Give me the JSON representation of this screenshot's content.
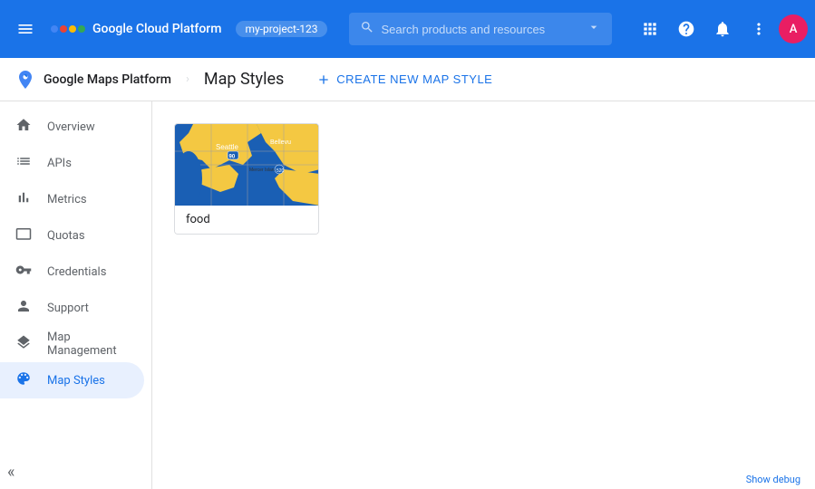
{
  "top_nav": {
    "menu_icon": "☰",
    "app_title": "Google Cloud Platform",
    "project_name": "my-project-123",
    "search_placeholder": "Search products and resources",
    "icons": {
      "apps": "⊞",
      "help": "?",
      "notifications": "🔔",
      "more": "⋮"
    },
    "avatar_text": "A"
  },
  "sub_header": {
    "logo_alt": "Google Maps Platform",
    "brand": "Google Maps Platform",
    "divider": "/",
    "page_title": "Map Styles",
    "create_btn_label": "CREATE NEW MAP STYLE"
  },
  "sidebar": {
    "items": [
      {
        "id": "overview",
        "label": "Overview",
        "icon": "home"
      },
      {
        "id": "apis",
        "label": "APIs",
        "icon": "list"
      },
      {
        "id": "metrics",
        "label": "Metrics",
        "icon": "bar_chart"
      },
      {
        "id": "quotas",
        "label": "Quotas",
        "icon": "tablet"
      },
      {
        "id": "credentials",
        "label": "Credentials",
        "icon": "vpn_key"
      },
      {
        "id": "support",
        "label": "Support",
        "icon": "person"
      },
      {
        "id": "map_management",
        "label": "Map Management",
        "icon": "layers"
      },
      {
        "id": "map_styles",
        "label": "Map Styles",
        "icon": "palette",
        "active": true
      }
    ],
    "collapse_icon": "«"
  },
  "content": {
    "map_style_card": {
      "label": "food",
      "thumbnail_alt": "Seattle map thumbnail"
    }
  },
  "bottom_bar": {
    "label": "Show debug"
  }
}
